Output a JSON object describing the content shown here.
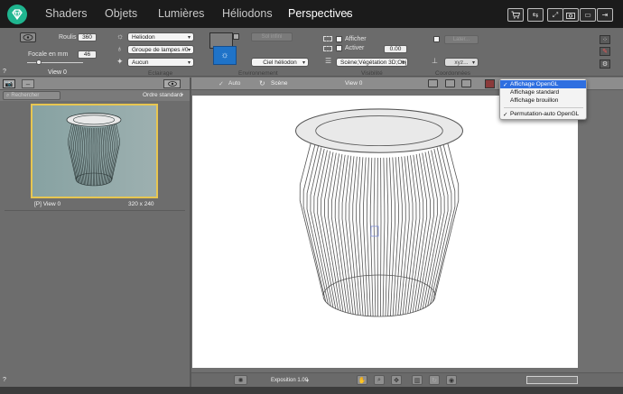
{
  "topbar": {
    "tabs": [
      "Shaders",
      "Objets",
      "Lumières",
      "Héliodons",
      "Perspectives"
    ],
    "active_tab": "Perspectives"
  },
  "camera": {
    "roulis_label": "Roulis",
    "roulis_value": "360",
    "focale_label": "Focale en mm",
    "focale_value": "46",
    "view_label": "View 0"
  },
  "eclairage": {
    "section": "Eclairage",
    "heliodon": "Heliodon",
    "lamp_group": "Groupe de lampes #0",
    "aucun": "Aucun"
  },
  "environnement": {
    "section": "Environnement",
    "sol_infini": "Sol infini",
    "ciel": "Ciel héliodon"
  },
  "visibilite": {
    "section": "Visibilité",
    "afficher": "Afficher",
    "activer": "Activer",
    "value": "0.00",
    "scene": "Scène;Végétation 3D;Obj"
  },
  "coordonnees": {
    "section": "Coordonnées",
    "later": "Later...",
    "xyz": "xyz..."
  },
  "help_mark": "?",
  "left_panel": {
    "search_placeholder": "Rechercher",
    "sort": "Ordre standard",
    "thumb_name": "[P] View 0",
    "thumb_size": "320 x 240",
    "help_mark": "?"
  },
  "viewport_toolbar": {
    "auto": "Auto",
    "scene": "Scène",
    "view": "View 0"
  },
  "menu": {
    "items": [
      "Affichage OpenGL",
      "Affichage standard",
      "Affichage brouillon",
      "Permutation-auto OpenGL"
    ],
    "checked": [
      "Affichage OpenGL",
      "Permutation-auto OpenGL"
    ]
  },
  "bottom": {
    "exposure": "Exposition 1.00"
  },
  "colors": {
    "accent": "#1fb58f",
    "selection": "#2f6fe0",
    "thumb_border": "#e7c651"
  }
}
